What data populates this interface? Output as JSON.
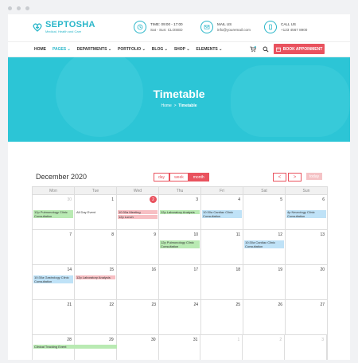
{
  "brand": {
    "name": "SEPTOSHA",
    "tagline": "Medical, Health and Care"
  },
  "contact": [
    {
      "icon": "clock-icon",
      "line1": "TIME: 09:00 - 17:00",
      "line2": "Sat - Sun: CLOSED"
    },
    {
      "icon": "mail-icon",
      "line1": "MAIL US",
      "line2": "info@youremail.com"
    },
    {
      "icon": "phone-icon",
      "line1": "CALL US",
      "line2": "+123 4567 8900"
    }
  ],
  "nav": {
    "items": [
      "HOME",
      "PAGES",
      "DEPARTMENTS",
      "PORTFOLIO",
      "BLOG",
      "SHOP",
      "ELEMENTS"
    ],
    "active": "PAGES",
    "book_label": "BOOK APPOINMENT"
  },
  "hero": {
    "title": "Timetable",
    "crumb_home": "Home",
    "crumb_sep": ">",
    "crumb_current": "Timetable"
  },
  "calendar": {
    "title": "December 2020",
    "views": [
      "day",
      "week",
      "month"
    ],
    "active_view": "month",
    "prev": "<",
    "next": ">",
    "today": "today",
    "weekdays": [
      "Mon",
      "Tue",
      "Wed",
      "Thu",
      "Fri",
      "Sat",
      "Sun"
    ],
    "weeks": [
      [
        "30",
        "1",
        "2",
        "3",
        "4",
        "5",
        "6"
      ],
      [
        "7",
        "8",
        "9",
        "10",
        "11",
        "12",
        "13"
      ],
      [
        "14",
        "15",
        "16",
        "17",
        "18",
        "19",
        "20"
      ],
      [
        "21",
        "22",
        "23",
        "24",
        "25",
        "26",
        "27"
      ],
      [
        "28",
        "29",
        "30",
        "31",
        "1",
        "2",
        "3"
      ]
    ],
    "events": {
      "w0_mon": "12p Pulmonology Clinic Consultation",
      "w0_tue": "All Day Event",
      "w0_wed_a": "10:30a Meeting",
      "w0_wed_b": "12p Lunch",
      "w0_thu": "12p Laboratory Analysis",
      "w0_fri": "10:30a Cardiac Clinic Consultation",
      "w0_sun": "4p Neurology Clinic Consultation",
      "w1_thu": "12p Pulmonology Clinic Consultation",
      "w1_sat": "10:30a Cardiac Clinic Consultation",
      "w2_mon": "10:30a Gastrology Clinic Consultation",
      "w2_tue": "12p Laboratory Analysis",
      "w4_mon": "Clinical Tracking Event"
    },
    "colors": {
      "green": "#b9eab3",
      "pink": "#f7bfc3",
      "blue": "#bfe2f7",
      "accent": "#e9525e",
      "brand": "#29b6c9"
    }
  }
}
